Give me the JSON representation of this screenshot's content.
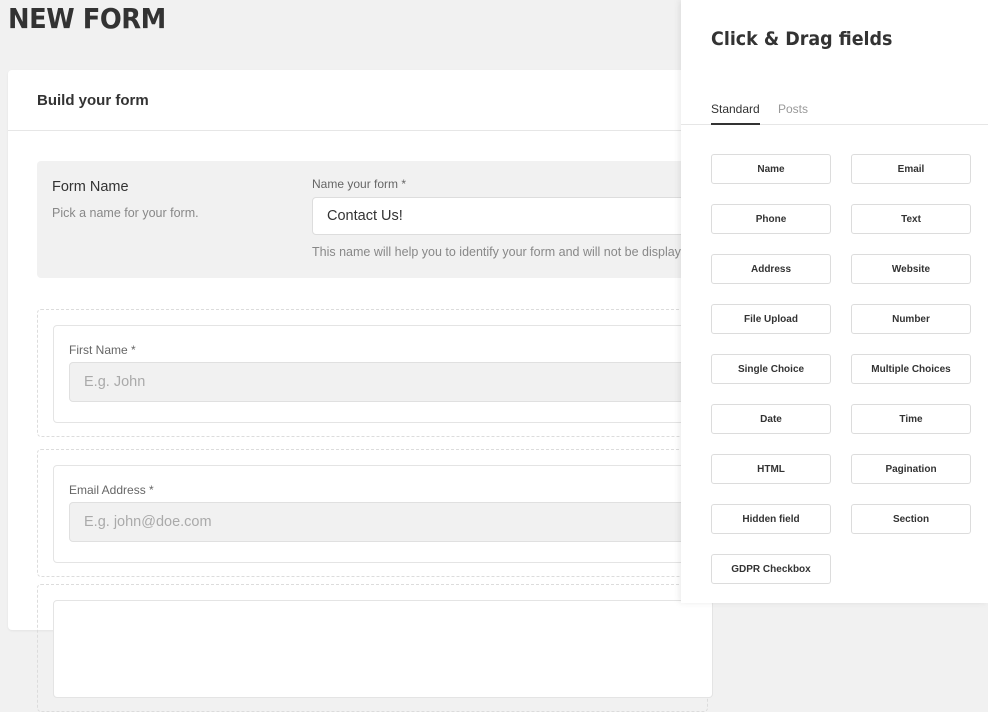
{
  "page": {
    "title": "NEW FORM"
  },
  "builder": {
    "header": "Build your form",
    "form_name": {
      "label": "Form Name",
      "description": "Pick a name for your form.",
      "field_label": "Name your form *",
      "value": "Contact Us!",
      "help": "This name will help you to identify your form and will not be displayed"
    },
    "fields": [
      {
        "label": "First Name *",
        "placeholder": "E.g. John"
      },
      {
        "label": "Email Address *",
        "placeholder": "E.g. john@doe.com"
      }
    ]
  },
  "panel": {
    "title": "Click & Drag fields",
    "tabs": [
      "Standard",
      "Posts"
    ],
    "active_tab": "Standard",
    "field_types": [
      "Name",
      "Email",
      "Phone",
      "Text",
      "Address",
      "Website",
      "File Upload",
      "Number",
      "Single Choice",
      "Multiple Choices",
      "Date",
      "Time",
      "HTML",
      "Pagination",
      "Hidden field",
      "Section",
      "GDPR Checkbox"
    ]
  }
}
